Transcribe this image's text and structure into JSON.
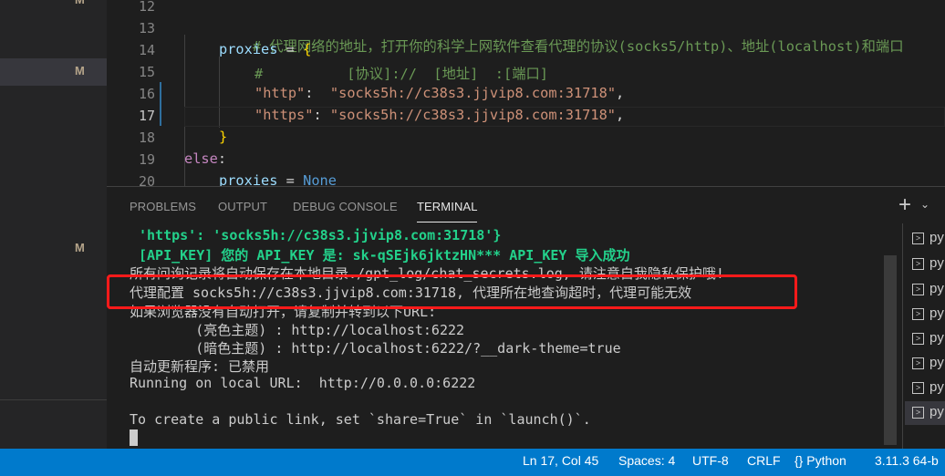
{
  "explorer": {
    "badges": [
      "M",
      "M",
      "M"
    ]
  },
  "editor": {
    "current_line": "17",
    "lines": [
      {
        "n": "12"
      },
      {
        "n": "13",
        "comment": "# 代理网络的地址，打开你的科学上网软件查看代理的协议(socks5/http)、地址(localhost)和端口"
      },
      {
        "n": "14",
        "var": "proxies",
        "op": " = ",
        "brace": "{"
      },
      {
        "n": "15",
        "comment": "#          [协议]://  [地址]  :[端口]"
      },
      {
        "n": "16",
        "key": "\"http\"",
        "sep": ":  ",
        "val": "\"socks5h://c38s3.jjvip8.com:31718\"",
        "tail": ","
      },
      {
        "n": "17",
        "key": "\"https\"",
        "sep": ": ",
        "val": "\"socks5h://c38s3.jjvip8.com:31718\"",
        "tail": ","
      },
      {
        "n": "18",
        "brace": "}"
      },
      {
        "n": "19",
        "kw": "else",
        "tail": ":"
      },
      {
        "n": "20",
        "var": "proxies",
        "op": " = ",
        "const": "None"
      }
    ]
  },
  "panel": {
    "tabs": [
      "PROBLEMS",
      "OUTPUT",
      "DEBUG CONSOLE",
      "TERMINAL"
    ],
    "active_tab": "TERMINAL",
    "terminal_lines": [
      {
        "text": "'https': 'socks5h://c38s3.jjvip8.com:31718'}",
        "style": "green"
      },
      {
        "text": "[API_KEY] 您的 API_KEY 是: sk-qSEjk6jktzHN*** API_KEY 导入成功",
        "style": "green"
      },
      {
        "text": "所有问询记录将自动保存在本地目录./gpt_log/chat_secrets.log, 请注意自我隐私保护哦!",
        "style": "normal"
      },
      {
        "text": "代理配置 socks5h://c38s3.jjvip8.com:31718, 代理所在地查询超时，代理可能无效",
        "style": "normal"
      },
      {
        "text": "如果浏览器没有自动打开，请复制并转到以下URL:",
        "style": "normal"
      },
      {
        "text": "        (亮色主题) : http://localhost:6222",
        "style": "normal"
      },
      {
        "text": "        (暗色主题) : http://localhost:6222/?__dark-theme=true",
        "style": "normal"
      },
      {
        "text": "自动更新程序: 已禁用",
        "style": "normal"
      },
      {
        "text": "Running on local URL:  http://0.0.0.0:6222",
        "style": "normal"
      },
      {
        "text": "",
        "style": "normal"
      },
      {
        "text": "To create a public link, set `share=True` in `launch()`.",
        "style": "normal"
      }
    ],
    "terminals": [
      "py",
      "py",
      "py",
      "py",
      "py",
      "py",
      "py",
      "py"
    ]
  },
  "status": {
    "position": "Ln 17, Col 45",
    "spaces": "Spaces: 4",
    "encoding": "UTF-8",
    "eol": "CRLF",
    "language": "Python",
    "interpreter": "3.11.3 64-b"
  },
  "colors": {
    "accent": "#007acc",
    "highlight_box": "#ff1a1a",
    "terminal_green": "#23d18b"
  }
}
